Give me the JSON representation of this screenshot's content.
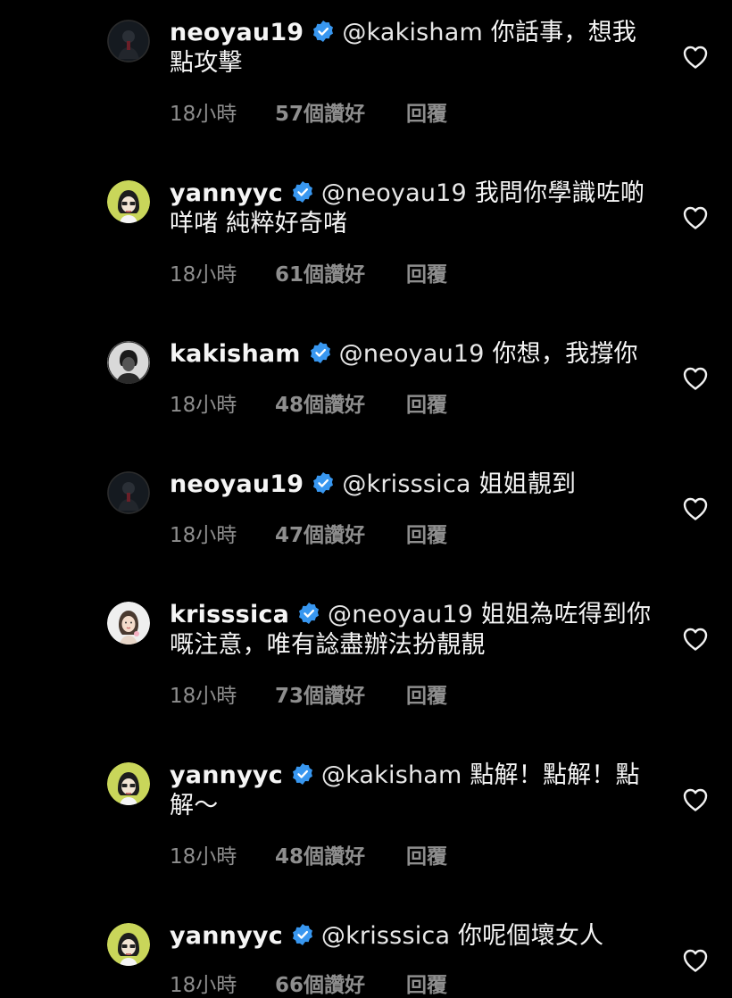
{
  "comments": [
    {
      "username": "neoyau19",
      "verified": true,
      "mention": "@kakisham",
      "text": "你話事，想我點攻擊",
      "time": "18小時",
      "likes": "57個讚好",
      "reply": "回覆",
      "avatar": "avatar-neoyau19"
    },
    {
      "username": "yannyyc",
      "verified": true,
      "mention": "@neoyau19",
      "text": "我問你學識咗啲咩啫 純粹好奇啫",
      "time": "18小時",
      "likes": "61個讚好",
      "reply": "回覆",
      "avatar": "avatar-yannyyc"
    },
    {
      "username": "kakisham",
      "verified": true,
      "mention": "@neoyau19",
      "text": "你想，我撐你",
      "time": "18小時",
      "likes": "48個讚好",
      "reply": "回覆",
      "avatar": "avatar-kakisham"
    },
    {
      "username": "neoyau19",
      "verified": true,
      "mention": "@krisssica",
      "text": "姐姐靚到",
      "time": "18小時",
      "likes": "47個讚好",
      "reply": "回覆",
      "avatar": "avatar-neoyau19"
    },
    {
      "username": "krisssica",
      "verified": true,
      "mention": "@neoyau19",
      "text": "姐姐為咗得到你嘅注意，唯有諗盡辦法扮靚靚",
      "time": "18小時",
      "likes": "73個讚好",
      "reply": "回覆",
      "avatar": "avatar-krisssica"
    },
    {
      "username": "yannyyc",
      "verified": true,
      "mention": "@kakisham",
      "text": "點解！點解！點解～",
      "time": "18小時",
      "likes": "48個讚好",
      "reply": "回覆",
      "avatar": "avatar-yannyyc"
    },
    {
      "username": "yannyyc",
      "verified": true,
      "mention": "@krisssica",
      "text": "你呢個壞女人",
      "time": "18小時",
      "likes": "66個讚好",
      "reply": "回覆",
      "avatar": "avatar-yannyyc"
    }
  ],
  "colors": {
    "background": "#000000",
    "text": "#f5f5f5",
    "meta": "#8e8e8e",
    "verified_badge": "#3897f0"
  },
  "icons": {
    "verified": "verified-badge-icon",
    "like": "heart-outline-icon"
  }
}
